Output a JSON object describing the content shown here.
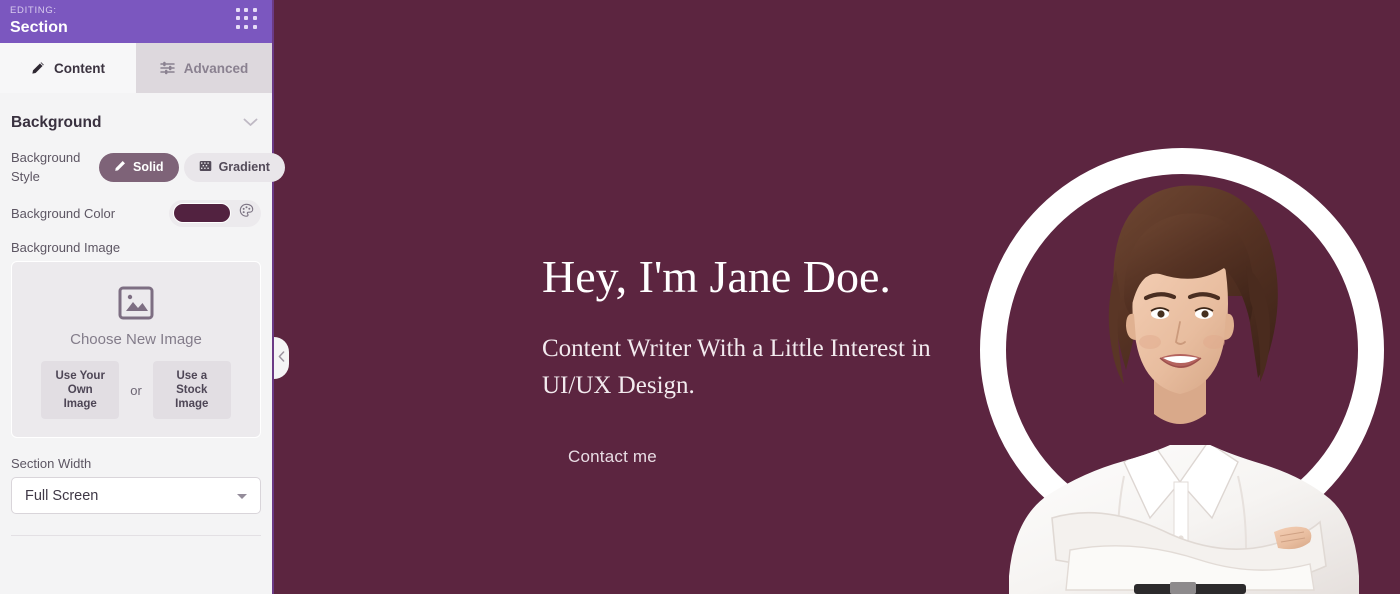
{
  "panel": {
    "header": {
      "editing_label": "EDITING:",
      "editing_name": "Section",
      "grid_icon": "grid-dots-icon"
    },
    "tabs": [
      {
        "label": "Content",
        "icon": "pencil-icon",
        "active": true
      },
      {
        "label": "Advanced",
        "icon": "sliders-icon",
        "active": false
      }
    ],
    "background_section": {
      "title": "Background",
      "collapse_icon": "chevron-down-icon",
      "background_style": {
        "label": "Background Style",
        "options": [
          {
            "label": "Solid",
            "icon": "pencil-icon",
            "selected": true
          },
          {
            "label": "Gradient",
            "icon": "gradient-icon",
            "selected": false
          }
        ]
      },
      "background_color": {
        "label": "Background Color",
        "value": "#522240",
        "picker_icon": "palette-icon"
      },
      "background_image": {
        "label": "Background Image",
        "placeholder_icon": "image-placeholder-icon",
        "title": "Choose New Image",
        "own_button": "Use Your\nOwn Image",
        "own_button_line1": "Use Your",
        "own_button_line2": "Own Image",
        "or_text": "or",
        "stock_button_line1": "Use a",
        "stock_button_line2": "Stock Image"
      },
      "section_width": {
        "label": "Section Width",
        "value": "Full Screen",
        "caret_icon": "caret-down-icon"
      }
    },
    "collapse_handle_icon": "chevron-left-icon"
  },
  "canvas": {
    "background_color": "#5c2540",
    "hero": {
      "title": "Hey, I'm Jane Doe.",
      "subtitle": "Content Writer With a Little Interest in UI/UX Design.",
      "cta": "Contact me",
      "image_alt": "smiling-woman-arms-crossed-portrait"
    }
  },
  "colors": {
    "panel_header_purple": "#7b57bf",
    "canvas_plum": "#5c2540",
    "solid_toggle_active": "#7e6378",
    "panel_bg": "#f4f4f5",
    "tab_active_bg": "#f7f7f8",
    "tab_inactive_bg": "#ddd8dd"
  }
}
